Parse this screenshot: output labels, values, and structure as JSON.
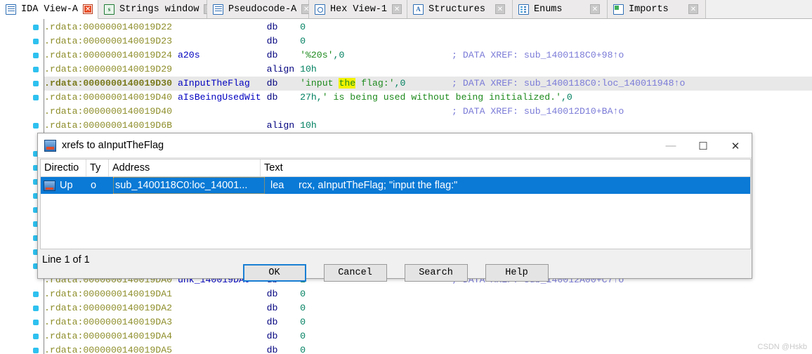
{
  "tabs": [
    {
      "label": "IDA View-A",
      "icon": "document-icon",
      "active": true,
      "close": "x",
      "close_style": "red"
    },
    {
      "label": "Strings window",
      "icon": "strings-icon",
      "active": false,
      "close": "x",
      "close_style": "grey"
    },
    {
      "label": "Pseudocode-A",
      "icon": "document-icon",
      "active": false,
      "close": "x",
      "close_style": "grey"
    },
    {
      "label": "Hex View-1",
      "icon": "hex-icon",
      "active": false,
      "close": "x",
      "close_style": "grey"
    },
    {
      "label": "Structures",
      "icon": "structures-icon",
      "active": false,
      "close": "x",
      "close_style": "grey"
    },
    {
      "label": "Enums",
      "icon": "enums-icon",
      "active": false,
      "close": "x",
      "close_style": "grey"
    },
    {
      "label": "Imports",
      "icon": "imports-icon",
      "active": false,
      "close": "x",
      "close_style": "grey"
    }
  ],
  "disassembly": {
    "lines": [
      {
        "addr": ".rdata:0000000140019D22",
        "name": "",
        "mnem": "db",
        "operand": "0",
        "comment": "",
        "highlight": false,
        "dot": true
      },
      {
        "addr": ".rdata:0000000140019D23",
        "name": "",
        "mnem": "db",
        "operand": "0",
        "comment": "",
        "highlight": false,
        "dot": true
      },
      {
        "addr": ".rdata:0000000140019D24",
        "name": "a20s",
        "mnem": "db",
        "operand": "'%20s',0",
        "comment": "; DATA XREF: sub_1400118C0+98↑o",
        "highlight": false,
        "dot": true
      },
      {
        "addr": ".rdata:0000000140019D29",
        "name": "",
        "mnem": "align",
        "operand": "10h",
        "comment": "",
        "highlight": false,
        "dot": true
      },
      {
        "addr": ".rdata:0000000140019D30",
        "name": "aInputTheFlag",
        "mnem": "db",
        "operand": "'input the flag:',0",
        "comment": "; DATA XREF: sub_1400118C0:loc_140011948↑o",
        "highlight": true,
        "dot": true
      },
      {
        "addr": ".rdata:0000000140019D40",
        "name": "aIsBeingUsedWit",
        "mnem": "db",
        "operand": "27h,' is being used without being initialized.',0",
        "comment": "",
        "highlight": false,
        "dot": true
      },
      {
        "addr": ".rdata:0000000140019D40",
        "name": "",
        "mnem": "",
        "operand": "",
        "comment": "; DATA XREF: sub_140012D10+BA↑o",
        "highlight": false,
        "dot": false
      },
      {
        "addr": ".rdata:0000000140019D6B",
        "name": "",
        "mnem": "align",
        "operand": "10h",
        "comment": "",
        "highlight": false,
        "dot": true
      }
    ],
    "lines_bottom": [
      {
        "addr": ".rdata:0000000140019DA0",
        "name": "unk_140019DA0",
        "mnem": "db",
        "operand": "1",
        "comment": "; DATA XREF: sub_140012A00+C7↑o",
        "dot": false
      },
      {
        "addr": ".rdata:0000000140019DA1",
        "name": "",
        "mnem": "db",
        "operand": "0",
        "comment": "",
        "dot": true
      },
      {
        "addr": ".rdata:0000000140019DA2",
        "name": "",
        "mnem": "db",
        "operand": "0",
        "comment": "",
        "dot": true
      },
      {
        "addr": ".rdata:0000000140019DA3",
        "name": "",
        "mnem": "db",
        "operand": "0",
        "comment": "",
        "dot": true
      },
      {
        "addr": ".rdata:0000000140019DA4",
        "name": "",
        "mnem": "db",
        "operand": "0",
        "comment": "",
        "dot": true
      },
      {
        "addr": ".rdata:0000000140019DA5",
        "name": "",
        "mnem": "db",
        "operand": "0",
        "comment": "",
        "dot": true
      }
    ],
    "highlight_word": "the",
    "highlight_color": "#f2f200"
  },
  "dialog": {
    "title": "xrefs to aInputTheFlag",
    "window_buttons": {
      "minimize": "—",
      "maximize": "☐",
      "close": "✕"
    },
    "columns": [
      "Directio",
      "Ty",
      "Address",
      "Text"
    ],
    "rows": [
      {
        "direction": "Up",
        "type": "o",
        "address": "sub_1400118C0:loc_14001...",
        "mnemonic": "lea",
        "text": "rcx, aInputTheFlag; \"input the flag:\"",
        "selected": true
      }
    ],
    "status": "Line 1 of 1",
    "buttons": [
      {
        "label": "OK",
        "default": true
      },
      {
        "label": "Cancel",
        "default": false
      },
      {
        "label": "Search",
        "default": false
      },
      {
        "label": "Help",
        "default": false
      }
    ],
    "selection_color": "#0a7ad6"
  },
  "watermark": "CSDN @Hskb"
}
